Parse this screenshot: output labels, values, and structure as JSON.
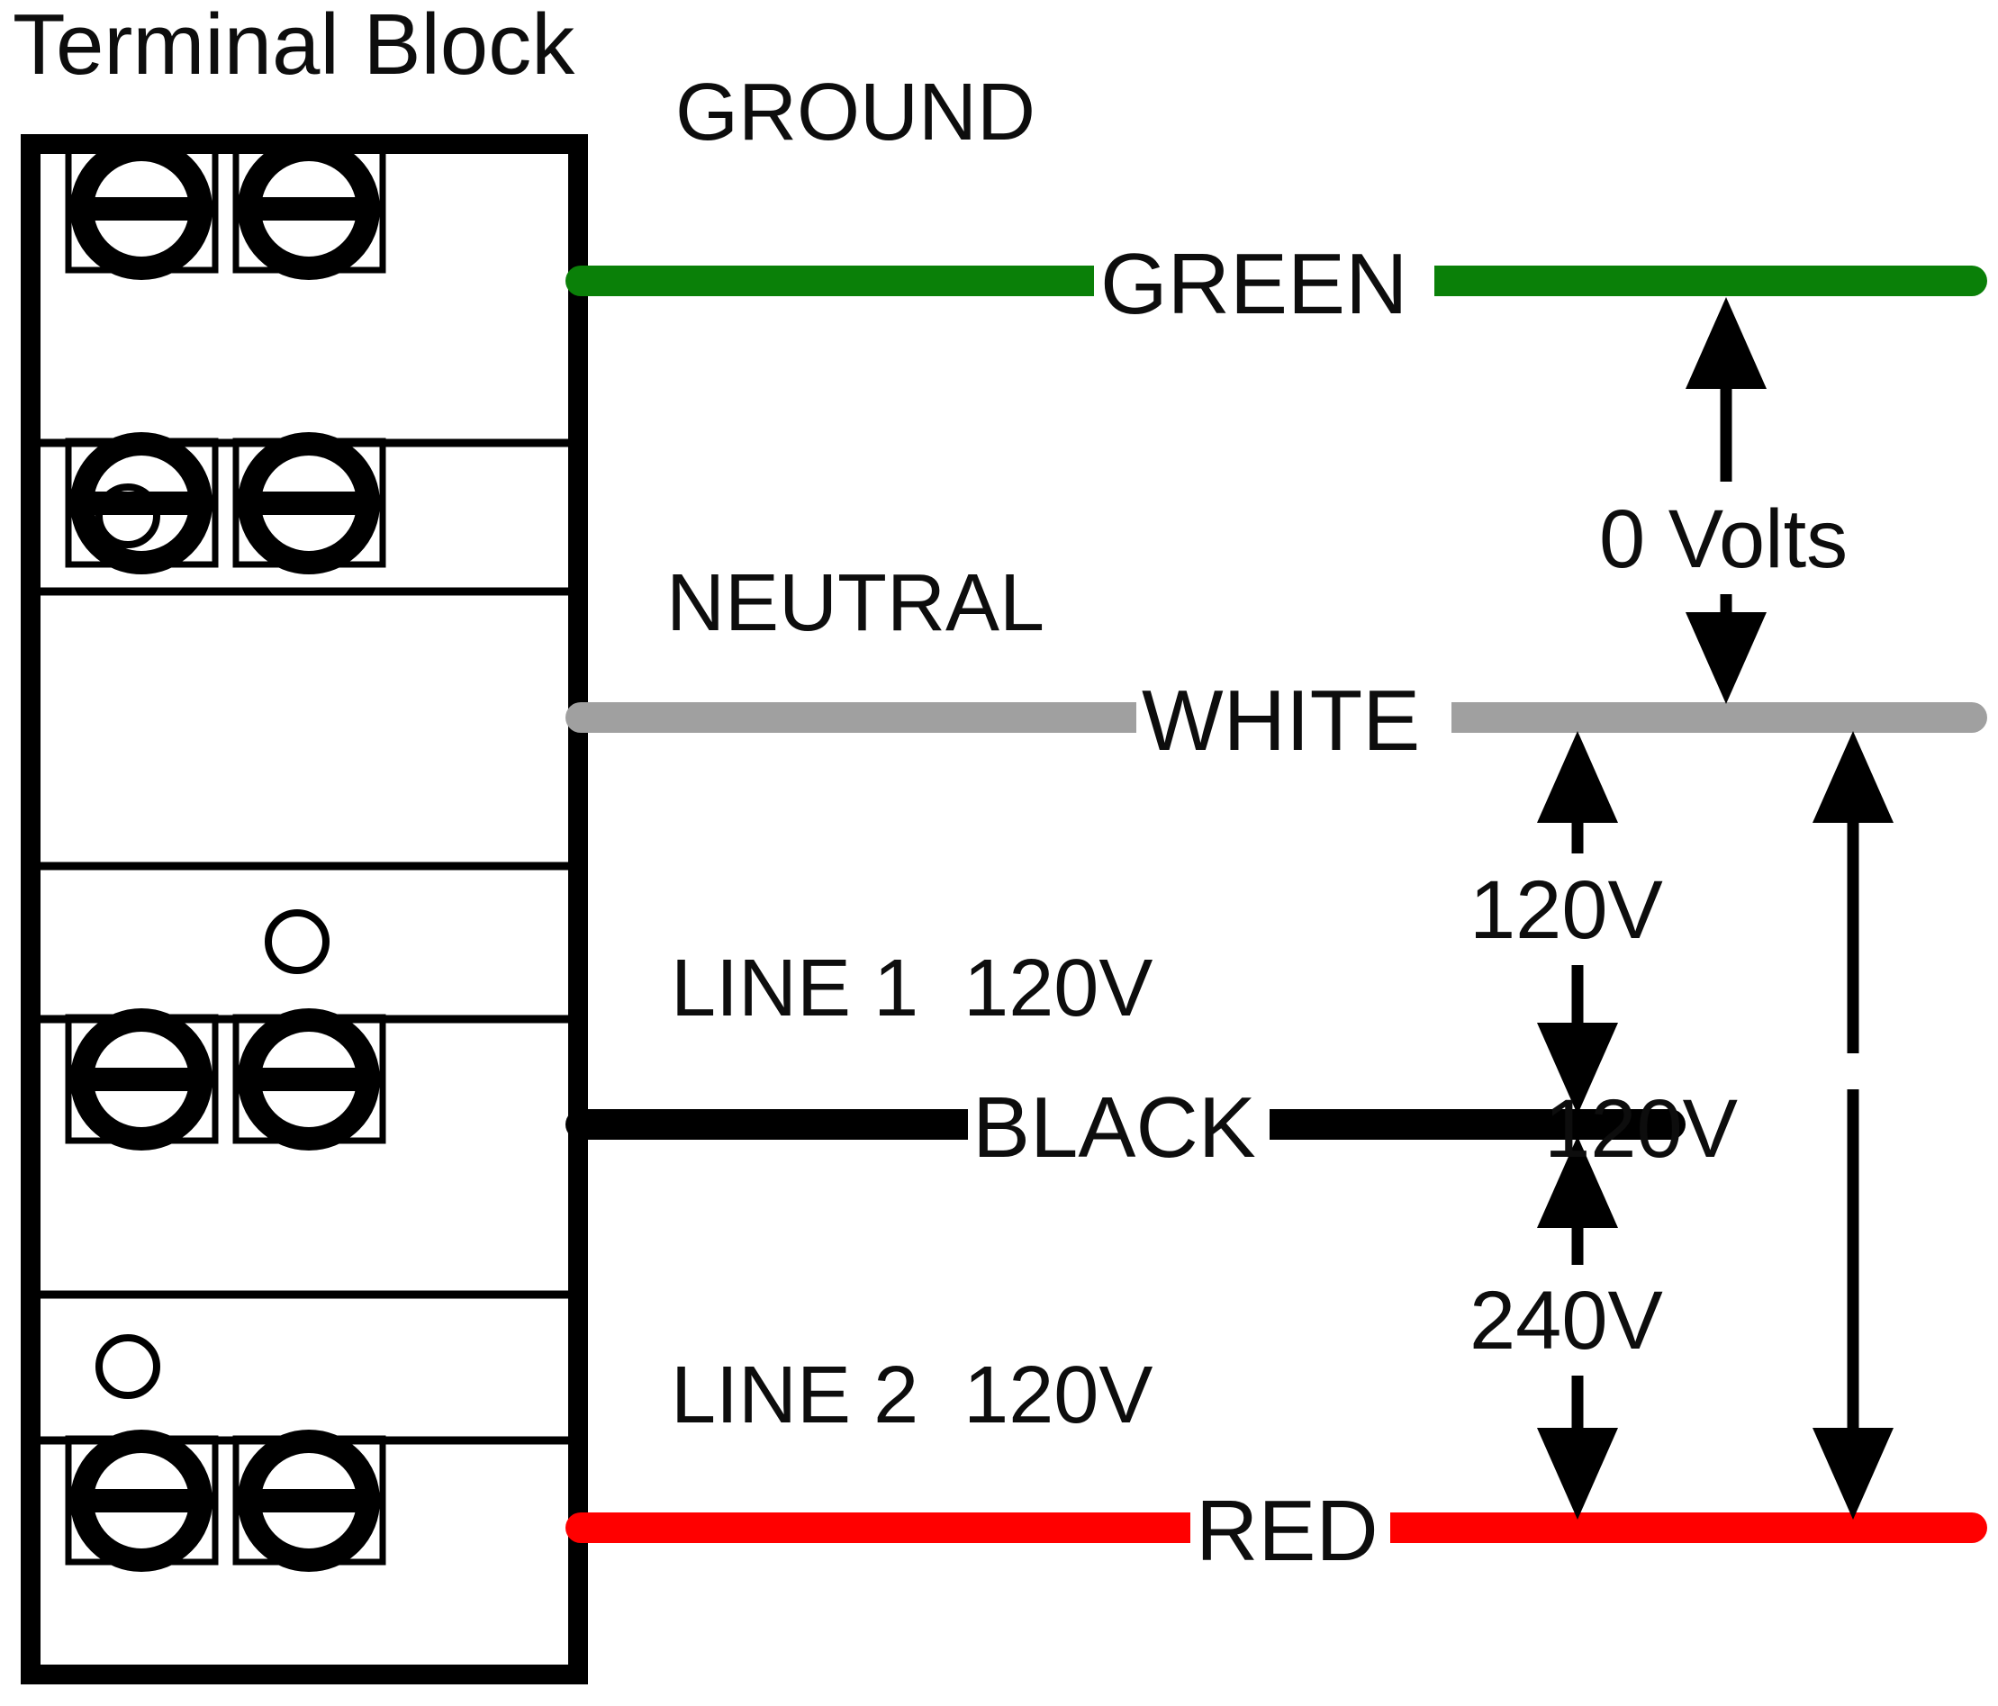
{
  "diagram": {
    "title": "Terminal Block",
    "kind": "electrical-wiring-diagram"
  },
  "terminal_block": {
    "label": "Terminal Block",
    "rows": [
      {
        "id": "ground-row",
        "screws": 2,
        "screw_icon": "slotted-screw-icon"
      },
      {
        "id": "neutral-row",
        "screws": 2,
        "screw_icon": "slotted-screw-icon"
      },
      {
        "id": "line1-row",
        "screws": 2,
        "screw_icon": "slotted-screw-icon"
      },
      {
        "id": "line2-row",
        "screws": 2,
        "screw_icon": "slotted-screw-icon"
      }
    ],
    "spacer_holes": [
      {
        "id": "hole-1",
        "side": "left"
      },
      {
        "id": "hole-2",
        "side": "right"
      },
      {
        "id": "hole-3",
        "side": "left"
      }
    ]
  },
  "conductors": [
    {
      "id": "ground",
      "role_label": "GROUND",
      "wire_label": "GREEN",
      "color": "#0a8008",
      "voltage": ""
    },
    {
      "id": "neutral",
      "role_label": "NEUTRAL",
      "wire_label": "WHITE",
      "color": "#a0a0a0",
      "voltage": ""
    },
    {
      "id": "line1",
      "role_label": "LINE 1  120V",
      "wire_label": "BLACK",
      "color": "#000000",
      "voltage": "120V"
    },
    {
      "id": "line2",
      "role_label": "LINE 2  120V",
      "wire_label": "RED",
      "color": "#ff0000",
      "voltage": "120V"
    }
  ],
  "measurements": [
    {
      "id": "ground-to-neutral",
      "label": "0 Volts",
      "from": "GREEN",
      "to": "WHITE"
    },
    {
      "id": "neutral-to-line1",
      "label": "120V",
      "from": "WHITE",
      "to": "BLACK"
    },
    {
      "id": "line1-to-line2",
      "label": "240V",
      "from": "BLACK",
      "to": "RED"
    },
    {
      "id": "neutral-to-line2",
      "label": "120V",
      "from": "WHITE",
      "to": "RED"
    }
  ],
  "colors": {
    "ground_green": "#0a8008",
    "neutral_gray": "#a0a0a0",
    "line1_black": "#000000",
    "line2_red": "#ff0000",
    "ink": "#0d0d0d",
    "background": "#ffffff"
  }
}
